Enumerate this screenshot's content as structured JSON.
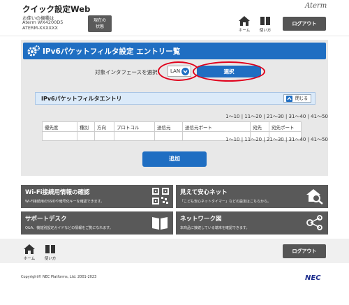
{
  "header": {
    "app_title": "クイック設定Web",
    "device_intro": "お使いの機種は",
    "device_model": "Aterm  WX4200D5",
    "device_id": "ATERM-XXXXXX",
    "status_label_line1": "現在の",
    "status_label_line2": "状態",
    "brand": "Aterm",
    "home_label": "ホーム",
    "help_label": "使い方",
    "logout_label": "ログアウト"
  },
  "main": {
    "title": "IPv6パケットフィルタ設定 エントリー覧",
    "interface_label": "対象インタフェースを選択",
    "interface_value": "LAN",
    "select_button": "選択",
    "entry_section_title": "IPv6パケットフィルタエントリ",
    "close_label": "閉じる",
    "pagination": "1～10 | 11～20 | 21～30 | 31～40 | 41～50",
    "table_headers": [
      "優先度",
      "種別",
      "方向",
      "プロトコル",
      "送信元",
      "送信元ポート",
      "宛先",
      "宛先ポート"
    ],
    "add_button": "追加"
  },
  "tiles": [
    {
      "title": "Wi-Fi接続用情報の確認",
      "desc": "Wi-Fi接続用のSSIDや暗号化キーを確認できます。",
      "icon": "qr-code-icon"
    },
    {
      "title": "見えて安心ネット",
      "desc": "「こども安心ネットタイマー」などの設定はこちらから。",
      "icon": "house-magnifier-icon"
    },
    {
      "title": "サポートデスク",
      "desc": "Q&A、機能別設定ガイドなどの情報をご覧になれます。",
      "icon": "book-icon"
    },
    {
      "title": "ネットワーク図",
      "desc": "本商品に接続している端末を確認できます。",
      "icon": "network-graph-icon"
    }
  ],
  "footer": {
    "home_label": "ホーム",
    "help_label": "使い方",
    "logout_label": "ログアウト",
    "copyright": "Copyright© NEC Platforms, Ltd. 2001-2023",
    "brand": "NEC"
  },
  "colors": {
    "accent_blue": "#1f6ec2",
    "highlight_red": "#e0001b",
    "tile_gray": "#595959"
  }
}
